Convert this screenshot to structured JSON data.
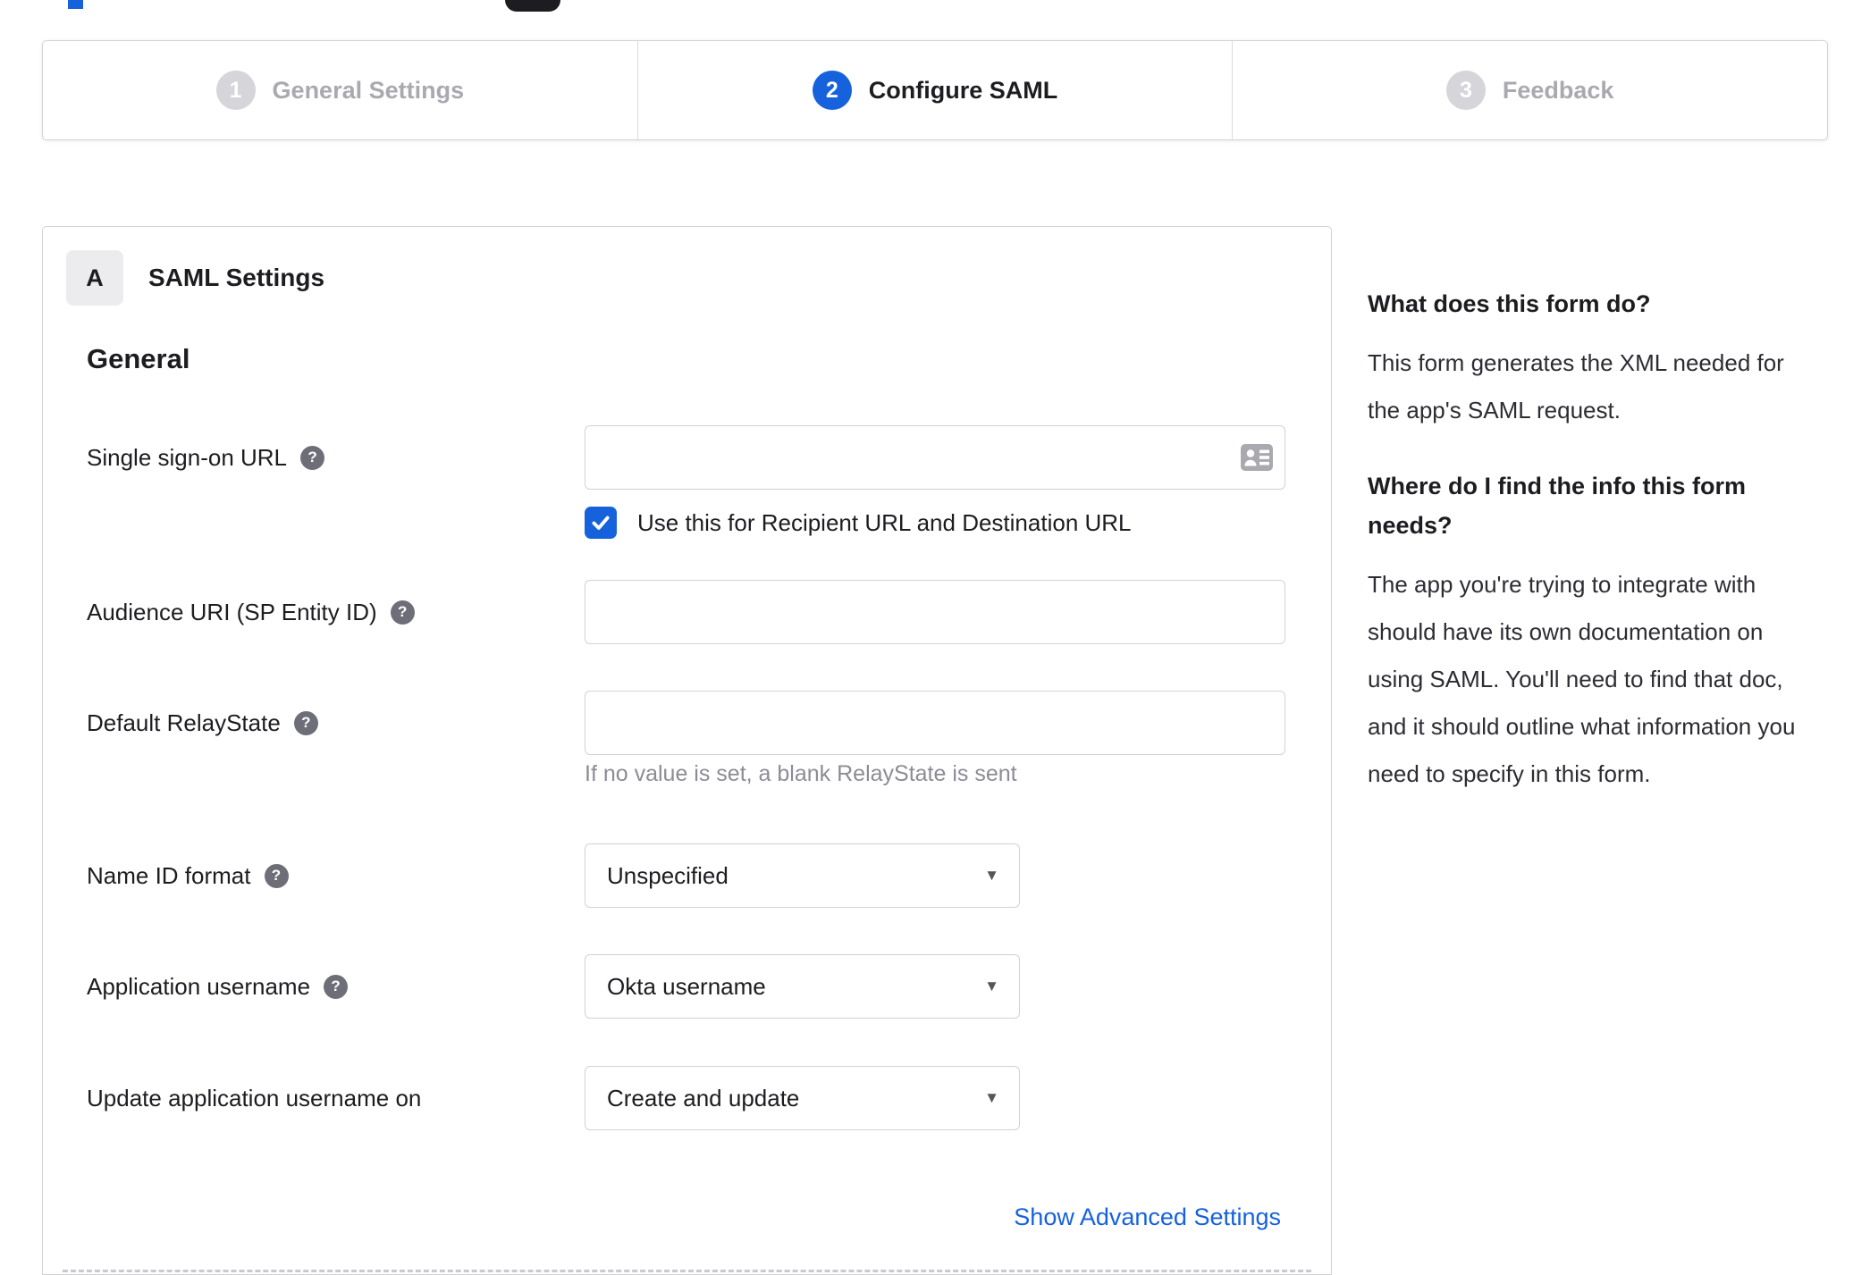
{
  "colors": {
    "accent_blue": "#1662dd",
    "border_gray": "#d2d2d7",
    "inactive_gray": "#a9a9b0",
    "hint_gray": "#8c8c96",
    "text_dark": "#1d1d21"
  },
  "stepper": {
    "steps": [
      {
        "number": "1",
        "label": "General Settings",
        "state": "inactive"
      },
      {
        "number": "2",
        "label": "Configure SAML",
        "state": "active"
      },
      {
        "number": "3",
        "label": "Feedback",
        "state": "inactive"
      }
    ]
  },
  "panel": {
    "badge": "A",
    "title": "SAML Settings",
    "group_heading": "General",
    "fields": {
      "sso": {
        "label": "Single sign-on URL",
        "value": "",
        "checkbox_label": "Use this for Recipient URL and Destination URL",
        "checkbox_checked": true
      },
      "audience": {
        "label": "Audience URI (SP Entity ID)",
        "value": ""
      },
      "relay": {
        "label": "Default RelayState",
        "value": "",
        "hint": "If no value is set, a blank RelayState is sent"
      },
      "name_id": {
        "label": "Name ID format",
        "value": "Unspecified"
      },
      "app_username": {
        "label": "Application username",
        "value": "Okta username"
      },
      "update_username": {
        "label": "Update application username on",
        "value": "Create and update"
      }
    },
    "advanced_link": "Show Advanced Settings"
  },
  "sidebar": {
    "s1": {
      "heading": "What does this form do?",
      "body": "This form generates the XML needed for the app's SAML request."
    },
    "s2": {
      "heading": "Where do I find the info this form needs?",
      "body": "The app you're trying to integrate with should have its own documentation on using SAML. You'll need to find that doc, and it should outline what information you need to specify in this form."
    }
  }
}
